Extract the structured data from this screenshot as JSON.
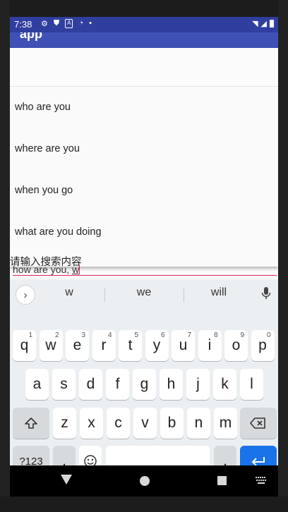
{
  "status_bar": {
    "time": "7:38",
    "icons": [
      "settings-icon",
      "shield-icon",
      "a-icon",
      "wifi-question-icon",
      "dot-icon"
    ],
    "right_icons": [
      "wifi-icon",
      "signal-icon",
      "battery-icon"
    ]
  },
  "app_bar": {
    "title": "app"
  },
  "suggestions": [
    "who are you",
    "where are you",
    "when you go",
    "what are you doing"
  ],
  "search": {
    "hint": "请输入搜索内容",
    "typed_prefix": "how are you, ",
    "typed_current": "w"
  },
  "keyboard": {
    "suggestions": [
      "w",
      "we",
      "will"
    ],
    "row1": [
      {
        "k": "q",
        "n": "1"
      },
      {
        "k": "w",
        "n": "2"
      },
      {
        "k": "e",
        "n": "3"
      },
      {
        "k": "r",
        "n": "4"
      },
      {
        "k": "t",
        "n": "5"
      },
      {
        "k": "y",
        "n": "6"
      },
      {
        "k": "u",
        "n": "7"
      },
      {
        "k": "i",
        "n": "8"
      },
      {
        "k": "o",
        "n": "9"
      },
      {
        "k": "p",
        "n": "0"
      }
    ],
    "row2": [
      "a",
      "s",
      "d",
      "f",
      "g",
      "h",
      "j",
      "k",
      "l"
    ],
    "row3": [
      "z",
      "x",
      "c",
      "v",
      "b",
      "n",
      "m"
    ],
    "symbols_label": "?123",
    "comma_label": ",",
    "period_label": ".",
    "shift_icon": "shift-icon",
    "backspace_icon": "backspace-icon",
    "emoji_icon": "emoji-icon",
    "enter_icon": "enter-icon",
    "enter_color": "#1a73e8"
  },
  "nav_bar": {
    "icons": [
      "back-icon",
      "home-icon",
      "recents-icon",
      "keyboard-icon"
    ]
  }
}
